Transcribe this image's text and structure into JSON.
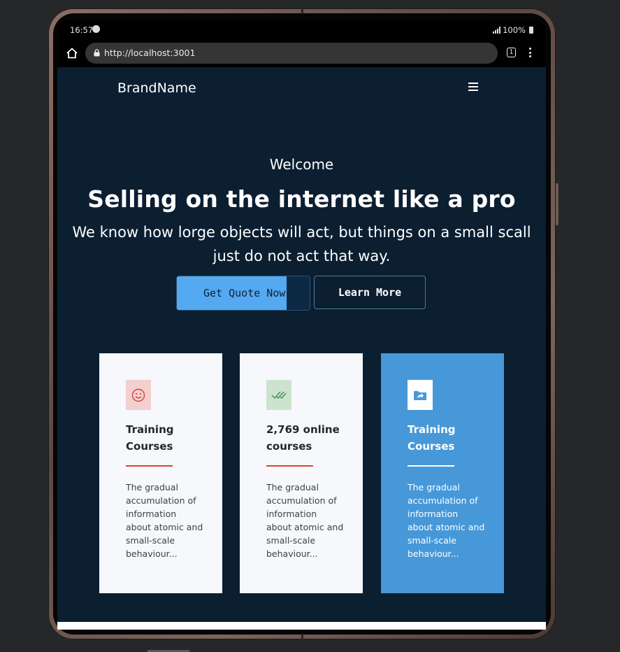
{
  "statusbar": {
    "time": "16:57",
    "battery": "100%"
  },
  "browser": {
    "url": "http://localhost:3001",
    "tab_count": "1"
  },
  "nav": {
    "brand": "BrandName"
  },
  "hero": {
    "welcome": "Welcome",
    "headline": "Selling on the internet like a pro",
    "subtitle": "We know how lorge objects will act, but things on a small scall just do not act that way.",
    "primary_button": "Get Quote Now",
    "secondary_button": "Learn More"
  },
  "cards": [
    {
      "icon": "smiley-icon",
      "icon_color": "#d9412f",
      "icon_bg": "#f3cfd0",
      "title": "Training Courses",
      "text": "The gradual accumulation of information about atomic and small-scale behaviour..."
    },
    {
      "icon": "double-check-icon",
      "icon_color": "#3f8f4f",
      "icon_bg": "#cde3cf",
      "title": "2,769 online courses",
      "text": "The gradual accumulation of information about atomic and small-scale behaviour..."
    },
    {
      "icon": "folder-share-icon",
      "icon_color": "#4798d8",
      "icon_bg": "#ffffff",
      "title": "Training Courses",
      "text": "The gradual accumulation of information about atomic and small-scale behaviour..."
    }
  ],
  "colors": {
    "page_bg": "#0b1f31",
    "accent_blue": "#55a9f0",
    "card_highlight": "#4798d8",
    "divider_red": "#d9412f"
  }
}
